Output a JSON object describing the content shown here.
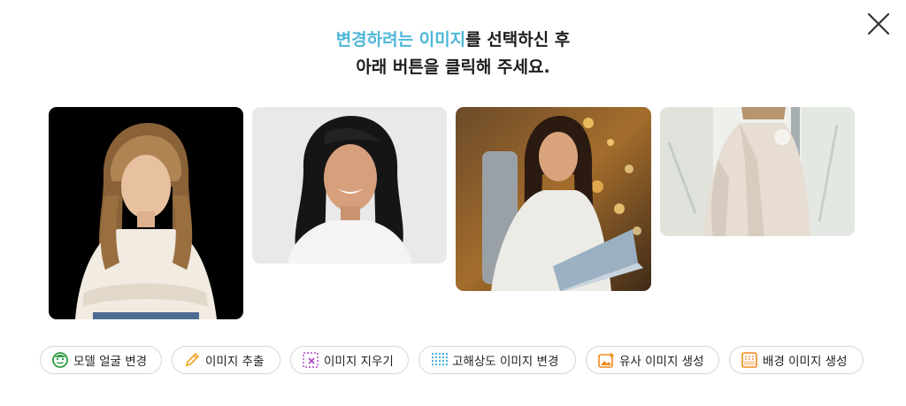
{
  "heading": {
    "line1_highlight": "변경하려는 이미지",
    "line1_rest": "를 선택하신 후",
    "line2": "아래 버튼을 클릭해 주세요."
  },
  "close_icon": "close-icon",
  "images": [
    {
      "name": "model-photo-black-background"
    },
    {
      "name": "model-photo-gray-background"
    },
    {
      "name": "model-photo-laptop-bokeh"
    },
    {
      "name": "model-photo-jacket-outdoor"
    }
  ],
  "actions": [
    {
      "label": "모델 얼굴 변경",
      "icon": "face-icon",
      "color": "#2e9b44"
    },
    {
      "label": "이미지 추출",
      "icon": "pencil-icon",
      "color": "#f2a21b"
    },
    {
      "label": "이미지 지우기",
      "icon": "erase-icon",
      "color": "#b044c8"
    },
    {
      "label": "고해상도 이미지 변경",
      "icon": "dot-grid-icon",
      "color": "#3da7e0"
    },
    {
      "label": "유사 이미지 생성",
      "icon": "image-sparkle-icon",
      "color": "#f08a1c"
    },
    {
      "label": "배경 이미지 생성",
      "icon": "background-icon",
      "color": "#f08a1c"
    }
  ]
}
